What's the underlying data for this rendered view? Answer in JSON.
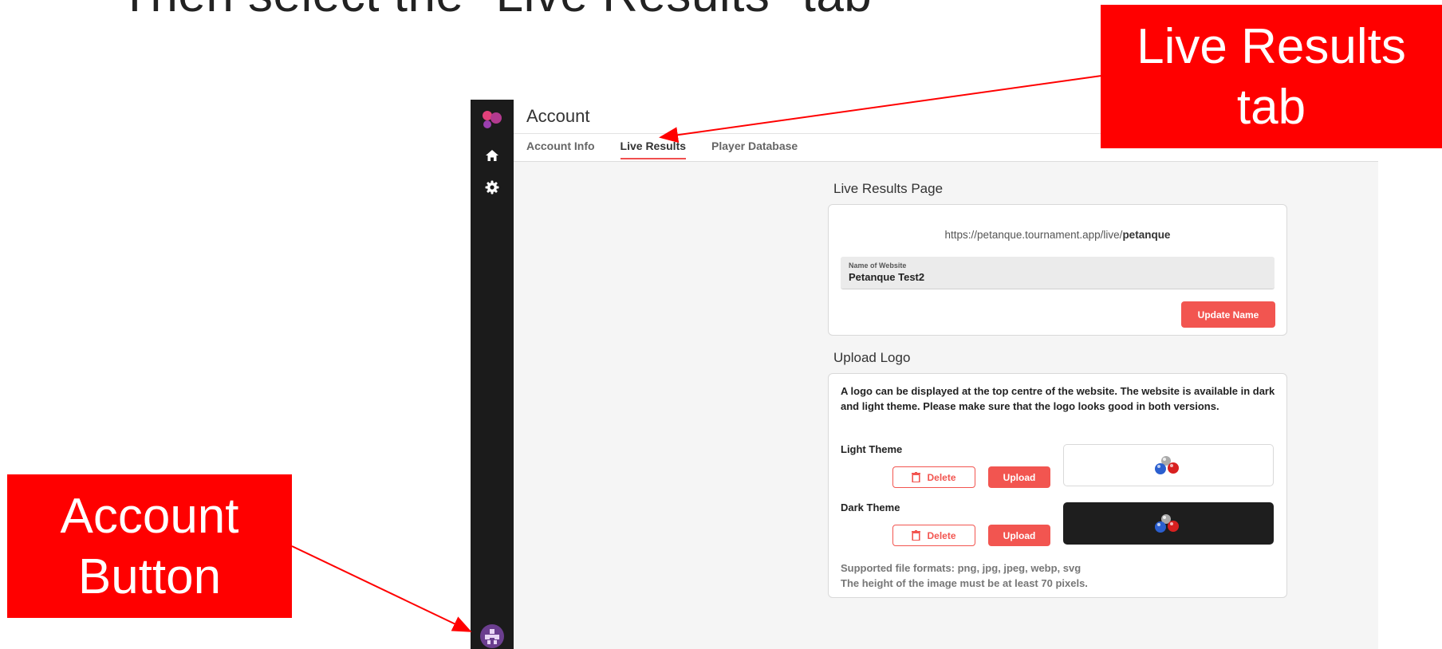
{
  "caption": {
    "top": "Then select the \"Live Results\" tab"
  },
  "annotations": {
    "live_results": "Live Results\ntab",
    "live_results_line1": "Live Results",
    "live_results_line2": "tab",
    "account_line1": "Account",
    "account_line2": "Button"
  },
  "sidebar": {
    "icons": [
      "app-logo",
      "home-icon",
      "gear-icon",
      "account-avatar"
    ]
  },
  "header": {
    "title": "Account",
    "tabs": [
      {
        "label": "Account Info",
        "active": false
      },
      {
        "label": "Live Results",
        "active": true
      },
      {
        "label": "Player Database",
        "active": false
      }
    ]
  },
  "live_results_page": {
    "title": "Live Results Page",
    "url_prefix": "https://petanque.tournament.app/live/",
    "url_slug": "petanque",
    "name_label": "Name of Website",
    "name_value": "Petanque Test2",
    "update_button": "Update Name"
  },
  "upload_logo": {
    "title": "Upload Logo",
    "description": "A logo can be displayed at the top centre of the website. The website is available in dark and light theme. Please make sure that the logo looks good in both versions.",
    "light_theme_label": "Light Theme",
    "dark_theme_label": "Dark Theme",
    "delete_button": "Delete",
    "upload_button": "Upload",
    "formats_line1": "Supported file formats: png, jpg, jpeg, webp, svg",
    "formats_line2": "The height of the image must be at least 70 pixels."
  },
  "colors": {
    "accent": "#f25550",
    "sidebar": "#1b1b1b",
    "callout": "#ff0000"
  }
}
